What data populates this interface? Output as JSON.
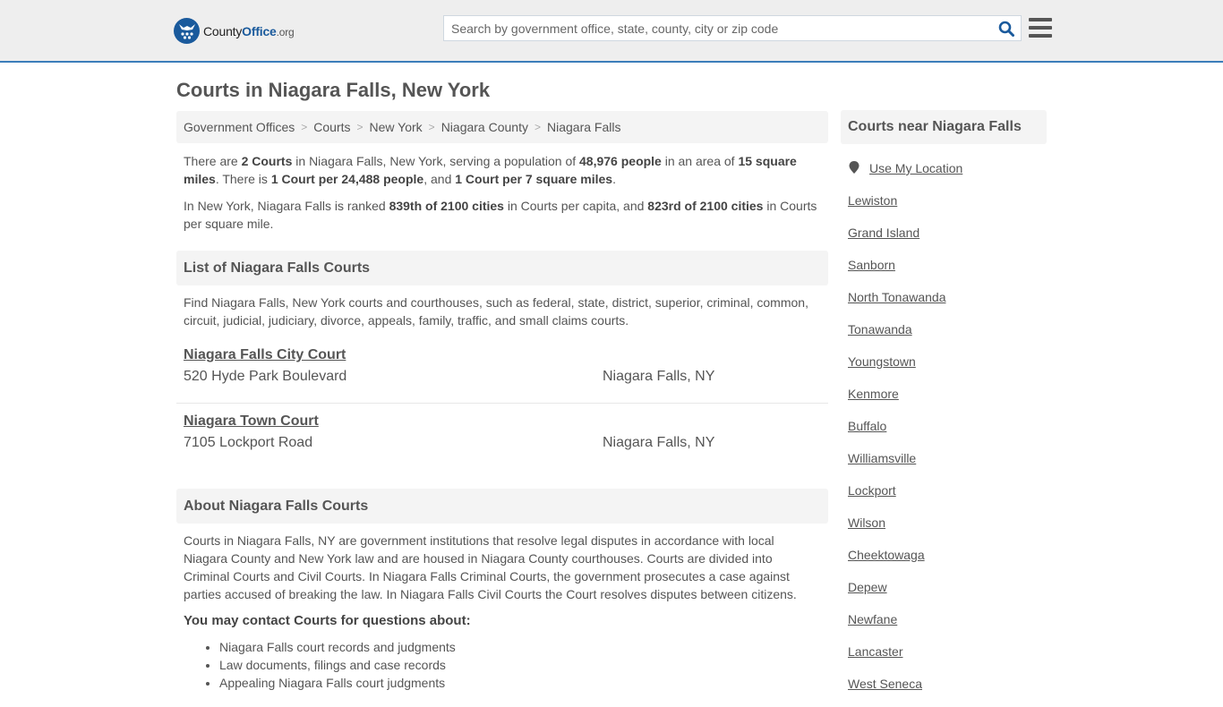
{
  "header": {
    "logo": {
      "brand_prefix": "County",
      "brand_main": "Office",
      "brand_suffix": ".org"
    },
    "search": {
      "placeholder": "Search by government office, state, county, city or zip code",
      "value": "",
      "icon": "search-icon"
    },
    "menu_icon": "hamburger-menu-icon",
    "colors": {
      "accent": "#1a5a9c",
      "divider": "#3b7dba",
      "header_bg": "#eeeeee"
    }
  },
  "page": {
    "title": "Courts in Niagara Falls, New York"
  },
  "breadcrumb": [
    {
      "label": "Government Offices"
    },
    {
      "label": "Courts"
    },
    {
      "label": "New York"
    },
    {
      "label": "Niagara County"
    },
    {
      "label": "Niagara Falls"
    }
  ],
  "summary": {
    "p1": {
      "t1": "There are ",
      "b1": "2 Courts",
      "t2": " in Niagara Falls, New York, serving a population of ",
      "b2": "48,976 people",
      "t3": " in an area of ",
      "b3": "15 square miles",
      "t4": ". There is ",
      "b4": "1 Court per 24,488 people",
      "t5": ", and ",
      "b5": "1 Court per 7 square miles",
      "t6": "."
    },
    "p2": {
      "t1": "In New York, Niagara Falls is ranked ",
      "b1": "839th of 2100 cities",
      "t2": " in Courts per capita, and ",
      "b2": "823rd of 2100 cities",
      "t3": " in Courts per square mile."
    }
  },
  "list_section": {
    "heading": "List of Niagara Falls Courts",
    "description": "Find Niagara Falls, New York courts and courthouses, such as federal, state, district, superior, criminal, common, circuit, judicial, judiciary, divorce, appeals, family, traffic, and small claims courts.",
    "courts": [
      {
        "name": "Niagara Falls City Court",
        "address": "520 Hyde Park Boulevard",
        "city": "Niagara Falls, NY"
      },
      {
        "name": "Niagara Town Court",
        "address": "7105 Lockport Road",
        "city": "Niagara Falls, NY"
      }
    ]
  },
  "about_section": {
    "heading": "About Niagara Falls Courts",
    "body": "Courts in Niagara Falls, NY are government institutions that resolve legal disputes in accordance with local Niagara County and New York law and are housed in Niagara County courthouses. Courts are divided into Criminal Courts and Civil Courts. In Niagara Falls Criminal Courts, the government prosecutes a case against parties accused of breaking the law. In Niagara Falls Civil Courts the Court resolves disputes between citizens.",
    "contact_heading": "You may contact Courts for questions about:",
    "bullets": [
      "Niagara Falls court records and judgments",
      "Law documents, filings and case records",
      "Appealing Niagara Falls court judgments"
    ]
  },
  "sidebar": {
    "heading": "Courts near Niagara Falls",
    "use_location": {
      "label": "Use My Location",
      "icon": "map-marker-icon"
    },
    "nearby": [
      "Lewiston",
      "Grand Island",
      "Sanborn",
      "North Tonawanda",
      "Tonawanda",
      "Youngstown",
      "Kenmore",
      "Buffalo",
      "Williamsville",
      "Lockport",
      "Wilson",
      "Cheektowaga",
      "Depew",
      "Newfane",
      "Lancaster",
      "West Seneca"
    ]
  }
}
